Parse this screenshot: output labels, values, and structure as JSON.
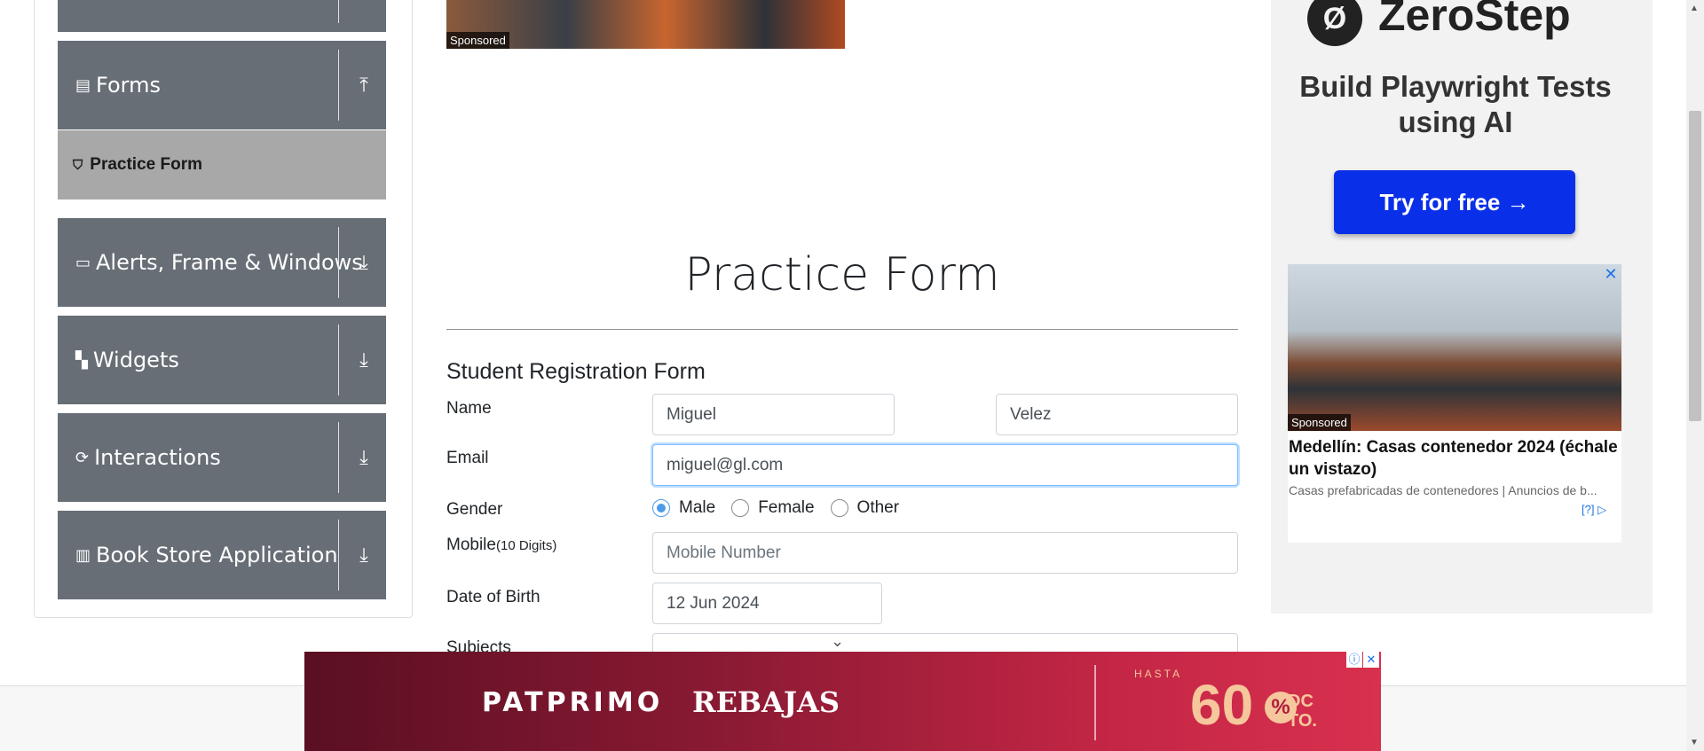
{
  "sidebar": {
    "groups": [
      {
        "label": "Forms",
        "icon": "document-icon",
        "arrow": "⤒"
      },
      {
        "label": "Alerts, Frame & Windows",
        "icon": "window-icon",
        "arrow": "⤓"
      },
      {
        "label": "Widgets",
        "icon": "widgets-icon",
        "arrow": "⤓"
      },
      {
        "label": "Interactions",
        "icon": "interactions-icon",
        "arrow": "⤓"
      },
      {
        "label": "Book Store Application",
        "icon": "books-icon",
        "arrow": "⤓"
      }
    ],
    "active_item": {
      "label": "Practice Form",
      "icon": "html5-icon"
    }
  },
  "top_ad": {
    "tag": "Sponsored"
  },
  "main": {
    "title": "Practice Form",
    "form_heading": "Student Registration Form",
    "labels": {
      "name": "Name",
      "email": "Email",
      "gender": "Gender",
      "mobile": "Mobile",
      "mobile_hint": "(10 Digits)",
      "dob": "Date of Birth",
      "subjects": "Subjects"
    },
    "first_name": "Miguel",
    "last_name": "Velez",
    "email": "miguel@gl.com",
    "gender_options": [
      "Male",
      "Female",
      "Other"
    ],
    "gender_selected": "Male",
    "mobile_placeholder": "Mobile Number",
    "dob": "12 Jun 2024"
  },
  "right_ad": {
    "brand": "ZeroStep",
    "tagline": "Build Playwright Tests using AI",
    "cta": "Try for free →",
    "card_tag": "Sponsored",
    "headline": "Medellín: Casas contenedor 2024 (échale un vistazo)",
    "source": "Casas prefabricadas de contenedores | Anuncios de b...",
    "choices": "[?]"
  },
  "banner": {
    "brand": "PATPRIMO",
    "sale": "REBAJAS",
    "hasta": "HASTA",
    "number": "60",
    "percent": "%",
    "dc": "DC",
    "to": "TO."
  },
  "colors": {
    "sidebar_group": "#676e76",
    "sidebar_active": "#a8a8a8",
    "cta_blue": "#0a2fe8",
    "radio_on": "#4d9be8"
  }
}
